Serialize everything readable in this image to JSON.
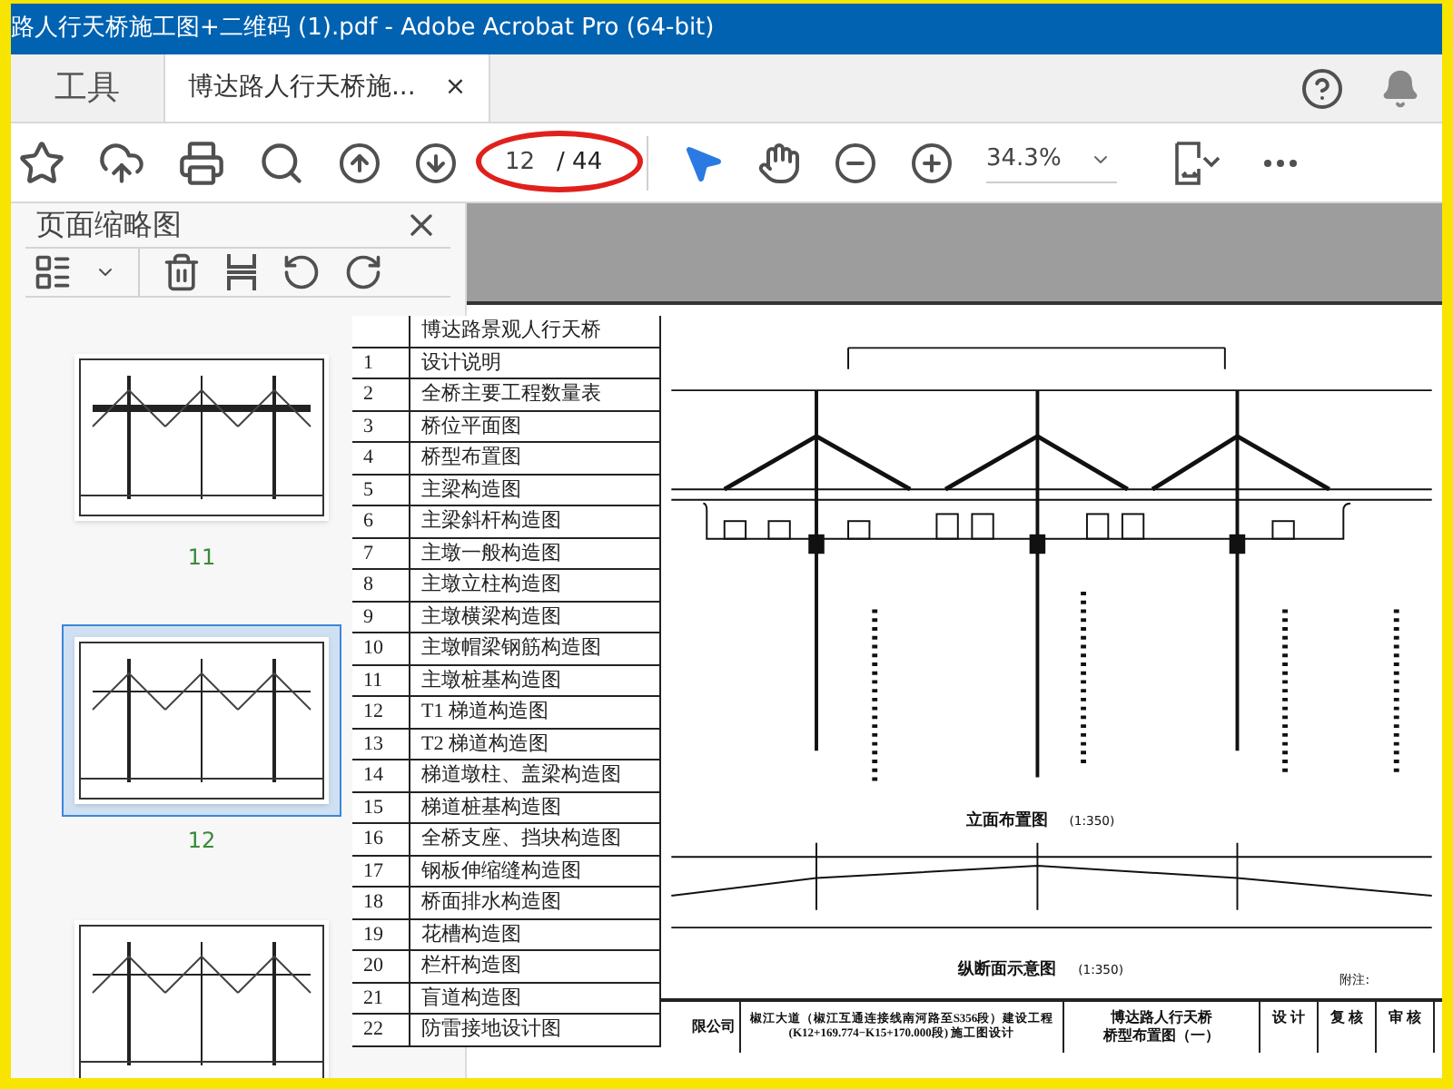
{
  "window": {
    "title": "路人行天桥施工图+二维码 (1).pdf - Adobe Acrobat Pro (64-bit)"
  },
  "tabs": [
    {
      "label": "工具",
      "selected": false
    },
    {
      "label": "博达路人行天桥施...",
      "selected": true,
      "close": "×"
    }
  ],
  "toolbar": {
    "page_number": "12",
    "page_total": "/ 44",
    "zoom": "34.3%",
    "tools": [
      {
        "kind": "select",
        "selected": true
      },
      {
        "kind": "hand",
        "selected": false
      }
    ]
  },
  "sidebar": {
    "title": "页面缩略图",
    "thumbnails": [
      {
        "label": "11",
        "selected": false
      },
      {
        "label": "12",
        "selected": true
      },
      {
        "selected": false
      }
    ]
  },
  "contents_table": {
    "heading": "博达路景观人行天桥",
    "rows": [
      {
        "number": "1",
        "title": "设计说明"
      },
      {
        "number": "2",
        "title": "全桥主要工程数量表"
      },
      {
        "number": "3",
        "title": "桥位平面图"
      },
      {
        "number": "4",
        "title": "桥型布置图"
      },
      {
        "number": "5",
        "title": "主梁构造图"
      },
      {
        "number": "6",
        "title": "主梁斜杆构造图"
      },
      {
        "number": "7",
        "title": "主墩一般构造图"
      },
      {
        "number": "8",
        "title": "主墩立柱构造图"
      },
      {
        "number": "9",
        "title": "主墩横梁构造图"
      },
      {
        "number": "10",
        "title": "主墩帽梁钢筋构造图"
      },
      {
        "number": "11",
        "title": "主墩桩基构造图"
      },
      {
        "number": "12",
        "title": "T1 梯道构造图"
      },
      {
        "number": "13",
        "title": "T2 梯道构造图"
      },
      {
        "number": "14",
        "title": "梯道墩柱、盖梁构造图"
      },
      {
        "number": "15",
        "title": "梯道桩基构造图"
      },
      {
        "number": "16",
        "title": "全桥支座、挡块构造图"
      },
      {
        "number": "17",
        "title": "钢板伸缩缝构造图"
      },
      {
        "number": "18",
        "title": "桥面排水构造图"
      },
      {
        "number": "19",
        "title": "花槽构造图"
      },
      {
        "number": "20",
        "title": "栏杆构造图"
      },
      {
        "number": "21",
        "title": "盲道构造图"
      },
      {
        "number": "22",
        "title": "防雷接地设计图"
      }
    ]
  },
  "drawing": {
    "elevation_caption": "立面布置图",
    "elevation_scale": "(1:350)",
    "profile_caption": "纵断面示意图",
    "profile_scale": "(1:350)",
    "note": "附注:",
    "title_block": {
      "company": "限公司",
      "project": [
        "椒江大道（椒江互通连接线南河路至S356段）建设工程",
        "(K12+169.774−K15+170.000段) 施工图设计"
      ],
      "sheet": [
        "博达路人行天桥",
        "桥型布置图（一）"
      ],
      "signatures": [
        "设 计",
        "复 核",
        "审 核"
      ]
    }
  }
}
